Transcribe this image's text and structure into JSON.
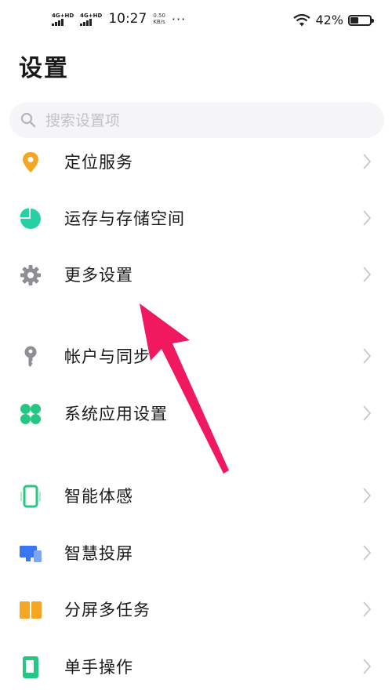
{
  "status_bar": {
    "sim1": "4G+HD",
    "sim2": "4G+HD",
    "time": "10:27",
    "speed_value": "0.50",
    "speed_unit": "KB/s",
    "more": "···",
    "battery": "42%",
    "battery_level": 0.42
  },
  "title": "设置",
  "search": {
    "placeholder": "搜索设置项"
  },
  "items": [
    {
      "label": "定位服务",
      "icon": "location-pin-icon",
      "color": "#f5a623"
    },
    {
      "label": "运存与存储空间",
      "icon": "pie-chart-icon",
      "color": "#26d0a5"
    },
    {
      "label": "更多设置",
      "icon": "gear-icon",
      "color": "#8e8e93"
    },
    {
      "label": "帐户与同步",
      "icon": "key-icon",
      "color": "#8e8e93"
    },
    {
      "label": "系统应用设置",
      "icon": "apps-grid-icon",
      "color": "#26c685"
    },
    {
      "label": "智能体感",
      "icon": "phone-motion-icon",
      "color": "#26c685"
    },
    {
      "label": "智慧投屏",
      "icon": "screen-cast-icon",
      "color": "#3a76f0"
    },
    {
      "label": "分屏多任务",
      "icon": "split-screen-icon",
      "color": "#f5a623"
    },
    {
      "label": "单手操作",
      "icon": "one-hand-icon",
      "color": "#26c685"
    }
  ],
  "annotation_color": "#f0185f"
}
